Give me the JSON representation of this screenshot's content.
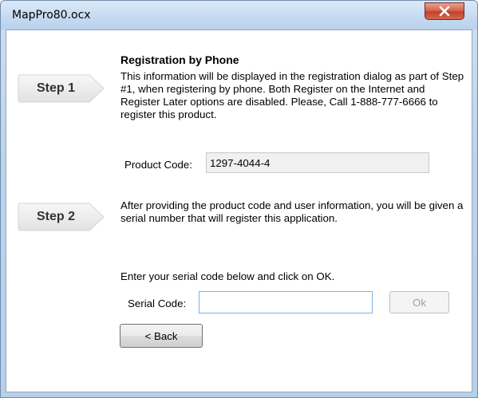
{
  "window": {
    "title": "MapPro80.ocx",
    "close_icon": "close-icon"
  },
  "dialog": {
    "heading": "Registration by Phone",
    "step1": {
      "label": "Step 1",
      "text": "This information will be displayed in the registration dialog as part of Step #1, when registering by phone. Both Register on the Internet and Register Later options are disabled. Please, Call 1-888-777-6666 to register this product."
    },
    "product_code": {
      "label": "Product Code:",
      "value": "1297-4044-4"
    },
    "step2": {
      "label": "Step 2",
      "text": "After providing the product code and user information, you will be given a serial number that will register this application."
    },
    "instruction": "Enter your serial code below and click on OK.",
    "serial_code": {
      "label": "Serial Code:",
      "value": "",
      "placeholder": ""
    },
    "ok_label": "Ok",
    "back_label": "< Back"
  },
  "colors": {
    "title_bar": "#c6dbf1",
    "close_button": "#c4402a",
    "step_badge": "#eaeaea",
    "input_focus_border": "#7eb4ea"
  }
}
